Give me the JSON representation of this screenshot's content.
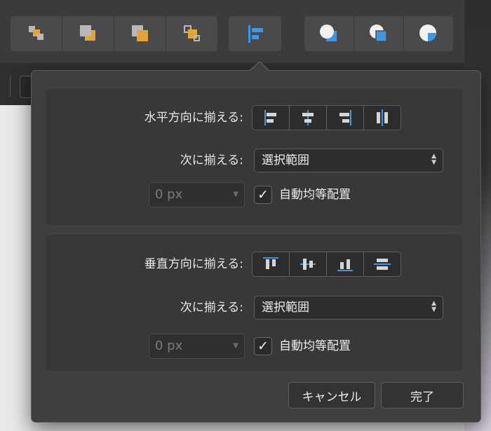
{
  "colors": {
    "accent_blue": "#3d97e6",
    "icon_orange": "#e3a33b",
    "icon_gray": "#b8b8b8",
    "icon_light": "#d6d6d6"
  },
  "toolbar": {
    "groups": [
      {
        "items": [
          {
            "name": "arrange-back-icon"
          },
          {
            "name": "arrange-backward-icon"
          },
          {
            "name": "arrange-forward-icon"
          },
          {
            "name": "arrange-front-icon"
          }
        ]
      },
      {
        "items": [
          {
            "name": "align-icon"
          }
        ]
      },
      {
        "items": [
          {
            "name": "boolean-add-icon"
          },
          {
            "name": "boolean-subtract-icon"
          },
          {
            "name": "boolean-intersect-icon"
          }
        ]
      }
    ]
  },
  "horizontal": {
    "label": "水平方向に揃える:",
    "align_to_label": "次に揃える:",
    "align_to_value": "選択範囲",
    "spacing_value": "0 px",
    "auto_distribute_label": "自動均等配置",
    "auto_distribute_checked": true,
    "buttons": [
      "align-left-icon",
      "align-center-h-icon",
      "align-right-icon",
      "distribute-h-icon"
    ]
  },
  "vertical": {
    "label": "垂直方向に揃える:",
    "align_to_label": "次に揃える:",
    "align_to_value": "選択範囲",
    "spacing_value": "0 px",
    "auto_distribute_label": "自動均等配置",
    "auto_distribute_checked": true,
    "buttons": [
      "align-top-icon",
      "align-middle-v-icon",
      "align-bottom-icon",
      "distribute-v-icon"
    ]
  },
  "footer": {
    "cancel_label": "キャンセル",
    "done_label": "完了"
  },
  "glyphs": {
    "check": "✓",
    "chev_up": "▲",
    "chev_down": "▼",
    "dropdown": "▼"
  }
}
